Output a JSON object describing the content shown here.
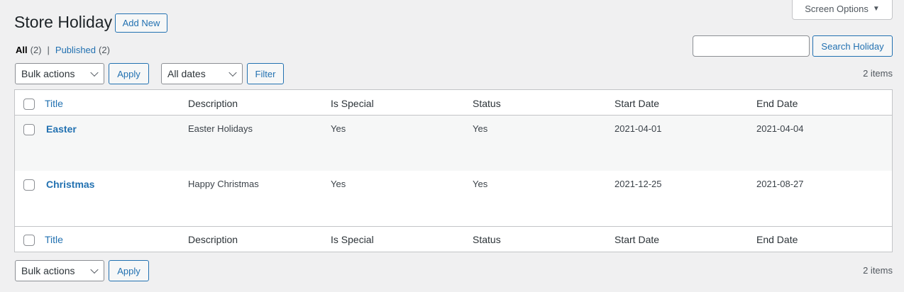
{
  "header": {
    "title": "Store Holiday",
    "add_new": "Add New",
    "screen_options": "Screen Options",
    "screen_options_arrow": "▼"
  },
  "views": {
    "all_label": "All",
    "all_count": "(2)",
    "separator": "|",
    "published_label": "Published",
    "published_count": "(2)"
  },
  "search": {
    "value": "",
    "button": "Search Holiday"
  },
  "top_nav": {
    "bulk_actions": "Bulk actions",
    "apply": "Apply",
    "dates": "All dates",
    "filter": "Filter",
    "items": "2 items"
  },
  "bottom_nav": {
    "bulk_actions": "Bulk actions",
    "apply": "Apply",
    "items": "2 items"
  },
  "table": {
    "columns": [
      "Title",
      "Description",
      "Is Special",
      "Status",
      "Start Date",
      "End Date"
    ],
    "rows": [
      {
        "title": "Easter",
        "description": "Easter Holidays",
        "is_special": "Yes",
        "status": "Yes",
        "start_date": "2021-04-01",
        "end_date": "2021-04-04"
      },
      {
        "title": "Christmas",
        "description": "Happy Christmas",
        "is_special": "Yes",
        "status": "Yes",
        "start_date": "2021-12-25",
        "end_date": "2021-08-27"
      }
    ]
  },
  "colors": {
    "accent": "#2271b1",
    "background": "#f0f0f1",
    "row_alt": "#f6f7f7"
  }
}
